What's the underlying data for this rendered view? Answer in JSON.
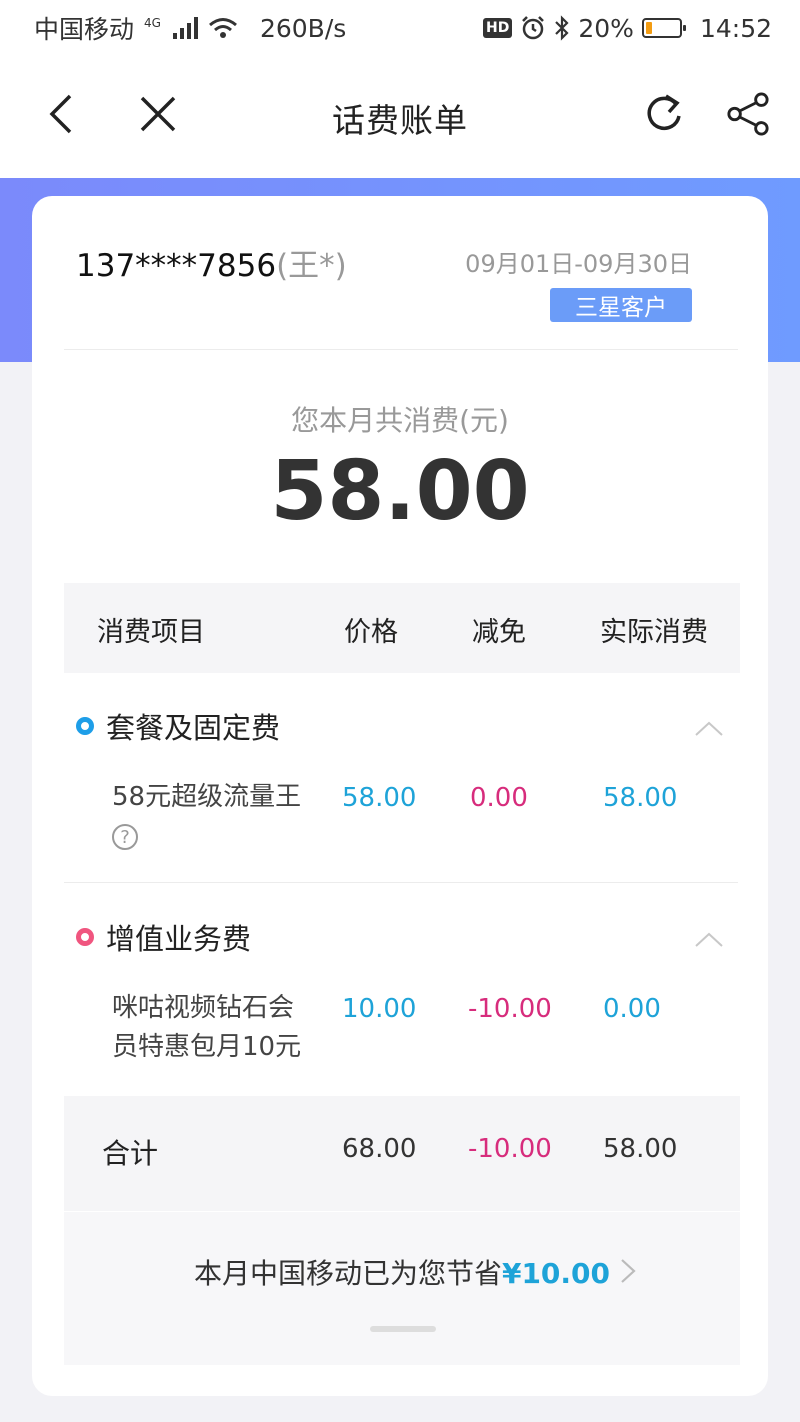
{
  "status_bar": {
    "carrier": "中国移动",
    "network": "4G",
    "speed": "260B/s",
    "hd": "HD",
    "battery_percent": "20%",
    "battery_level": 0.2,
    "time": "14:52"
  },
  "nav": {
    "title": "话费账单",
    "icons": [
      "back-icon",
      "close-icon",
      "refresh-icon",
      "share-icon"
    ]
  },
  "account": {
    "phone": "137****7856",
    "owner": "(王*)",
    "period": "09月01日-09月30日",
    "level": "三星客户"
  },
  "summary": {
    "caption": "您本月共消费(元)",
    "amount": "58.00"
  },
  "table": {
    "headers": [
      "消费项目",
      "价格",
      "减免",
      "实际消费"
    ],
    "categories": [
      {
        "name": "套餐及固定费",
        "dot_color": "#1e9ee8",
        "items": [
          {
            "name": "58元超级流量王",
            "price": "58.00",
            "discount": "0.00",
            "actual": "58.00"
          }
        ]
      },
      {
        "name": "增值业务费",
        "dot_color": "#f0557f",
        "items": [
          {
            "name": "咪咕视频钻石会员特惠包月10元",
            "price": "10.00",
            "discount": "-10.00",
            "actual": "0.00"
          }
        ]
      }
    ],
    "total": {
      "label": "合计",
      "price": "68.00",
      "discount": "-10.00",
      "actual": "58.00"
    }
  },
  "saving": {
    "prefix": "本月中国移动已为您节省",
    "amount": "¥10.00"
  },
  "colors": {
    "accent_blue": "#1ea3d8",
    "discount_pink": "#d72c7c",
    "header_gradient_start": "#7b8afb",
    "header_gradient_end": "#6f9bff",
    "badge": "#6b9cf8"
  }
}
